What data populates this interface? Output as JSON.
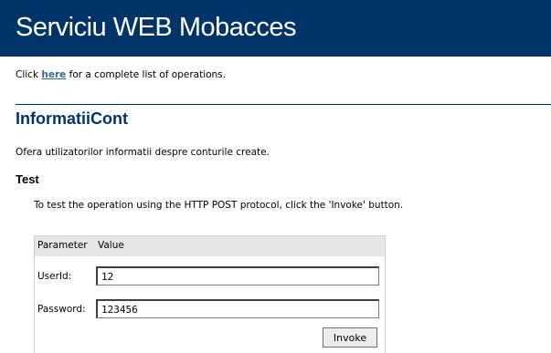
{
  "header": {
    "title": "Serviciu WEB Mobacces"
  },
  "intro": {
    "prefix": "Click",
    "link": "here",
    "suffix": "for a complete list of operations."
  },
  "operation": {
    "title": "InformatiiCont",
    "description": "Ofera utilizatorilor informatii despre conturile create."
  },
  "test": {
    "title": "Test",
    "note": "To test the operation using the HTTP POST protocol, click the 'Invoke' button."
  },
  "form": {
    "columns": [
      "Parameter",
      "Value"
    ],
    "fields": [
      {
        "label": "UserId:",
        "value": "12"
      },
      {
        "label": "Password:",
        "value": "123456"
      }
    ],
    "invoke_label": "Invoke"
  }
}
